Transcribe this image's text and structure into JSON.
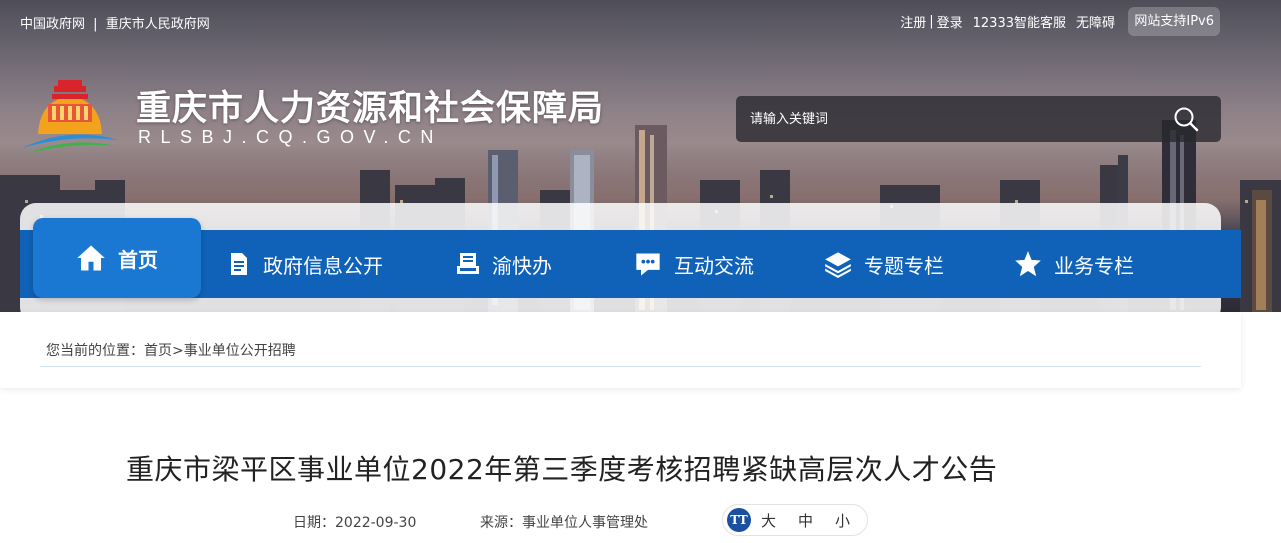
{
  "topbar": {
    "left_links": [
      "中国政府网",
      "重庆市人民政府网"
    ],
    "left_sep": "|",
    "register": "注册",
    "login": "登录",
    "sep": "|",
    "service": "12333智能客服",
    "accessibility": "无障碍",
    "ipv6": "网站支持IPv6"
  },
  "header": {
    "title": "重庆市人力资源和社会保障局",
    "domain": "RLSBJ.CQ.GOV.CN"
  },
  "search": {
    "placeholder": "请输入关键词",
    "icon": "search-icon"
  },
  "nav": {
    "items": [
      {
        "label": "首页",
        "icon": "home-icon",
        "active": true
      },
      {
        "label": "政府信息公开",
        "icon": "document-icon",
        "active": false
      },
      {
        "label": "渝快办",
        "icon": "book-stack-icon",
        "active": false
      },
      {
        "label": "互动交流",
        "icon": "chat-bubble-icon",
        "active": false
      },
      {
        "label": "专题专栏",
        "icon": "layers-icon",
        "active": false
      },
      {
        "label": "业务专栏",
        "icon": "star-icon",
        "active": false
      }
    ]
  },
  "breadcrumb": {
    "prefix": "您当前的位置：",
    "home": "首页",
    "sep": ">",
    "current": "事业单位公开招聘"
  },
  "article": {
    "title": "重庆市梁平区事业单位2022年第三季度考核招聘紧缺高层次人才公告",
    "date_label": "日期：2022-09-30",
    "source_label": "来源：事业单位人事管理处",
    "font_icon_text": "TT",
    "font_sizes": [
      "大",
      "中",
      "小"
    ]
  },
  "colors": {
    "nav_bg": "#0f62b8",
    "nav_active": "#1b78d2",
    "font_icon_bg": "#1b4fa0"
  }
}
